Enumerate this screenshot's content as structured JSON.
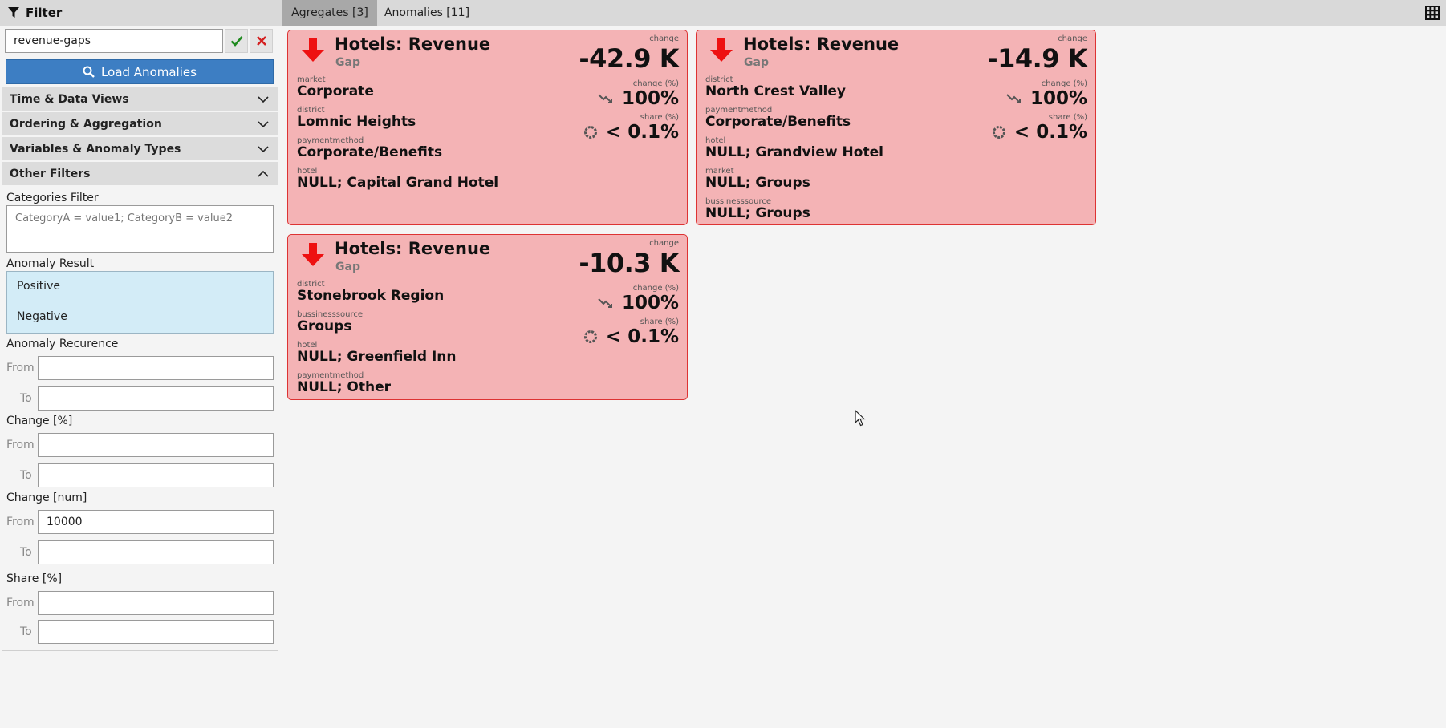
{
  "sidebar": {
    "title": "Filter",
    "filter_value": "revenue-gaps",
    "load_label": "Load Anomalies",
    "sections": [
      {
        "label": "Time & Data Views",
        "expanded": false
      },
      {
        "label": "Ordering & Aggregation",
        "expanded": false
      },
      {
        "label": "Variables & Anomaly Types",
        "expanded": false
      },
      {
        "label": "Other Filters",
        "expanded": true
      }
    ],
    "categories_label": "Categories Filter",
    "categories_placeholder": "CategoryA = value1; CategoryB = value2",
    "anomaly_result_label": "Anomaly Result",
    "anomaly_result_options": [
      "Positive",
      "Negative"
    ],
    "from_label": "From",
    "to_label": "To",
    "recurrence_label": "Anomaly Recurence",
    "change_pct_label": "Change [%]",
    "change_num_label": "Change [num]",
    "change_num_from": "10000",
    "share_label": "Share [%]"
  },
  "tabs": [
    {
      "label": "Agregates [3]",
      "active": true
    },
    {
      "label": "Anomalies [11]",
      "active": false
    }
  ],
  "cards": [
    {
      "title": "Hotels: Revenue",
      "subtitle": "Gap",
      "change_label": "change",
      "change_value": "-42.9 K",
      "change_pct_label": "change (%)",
      "change_pct": "100%",
      "share_label": "share (%)",
      "share": "< 0.1%",
      "dims": [
        {
          "key": "market",
          "value": "Corporate"
        },
        {
          "key": "district",
          "value": "Lomnic Heights"
        },
        {
          "key": "paymentmethod",
          "value": "Corporate/Benefits"
        },
        {
          "key": "hotel",
          "value": "NULL; Capital Grand Hotel"
        }
      ]
    },
    {
      "title": "Hotels: Revenue",
      "subtitle": "Gap",
      "change_label": "change",
      "change_value": "-14.9 K",
      "change_pct_label": "change (%)",
      "change_pct": "100%",
      "share_label": "share (%)",
      "share": "< 0.1%",
      "dims": [
        {
          "key": "district",
          "value": "North Crest Valley"
        },
        {
          "key": "paymentmethod",
          "value": "Corporate/Benefits"
        },
        {
          "key": "hotel",
          "value": "NULL; Grandview Hotel"
        },
        {
          "key": "market",
          "value": "NULL; Groups"
        },
        {
          "key": "bussinesssource",
          "value": "NULL; Groups"
        }
      ]
    },
    {
      "title": "Hotels: Revenue",
      "subtitle": "Gap",
      "change_label": "change",
      "change_value": "-10.3 K",
      "change_pct_label": "change (%)",
      "change_pct": "100%",
      "share_label": "share (%)",
      "share": "< 0.1%",
      "dims": [
        {
          "key": "district",
          "value": "Stonebrook Region"
        },
        {
          "key": "bussinesssource",
          "value": "Groups"
        },
        {
          "key": "hotel",
          "value": "NULL; Greenfield Inn"
        },
        {
          "key": "paymentmethod",
          "value": "NULL; Other"
        }
      ]
    }
  ],
  "colors": {
    "card_bg": "#f4b3b5",
    "card_border": "#dd3333",
    "arrow": "#ee1111",
    "load_button": "#3d7ec3",
    "result_list_bg": "#d3ecf7"
  },
  "icons": {
    "filter": "funnel-icon",
    "confirm": "checkmark-icon",
    "clear": "x-icon",
    "load": "search-icon",
    "grid": "table-icon",
    "trend": "trend-down-icon",
    "share": "pie-icon",
    "direction": "arrow-down-icon"
  }
}
